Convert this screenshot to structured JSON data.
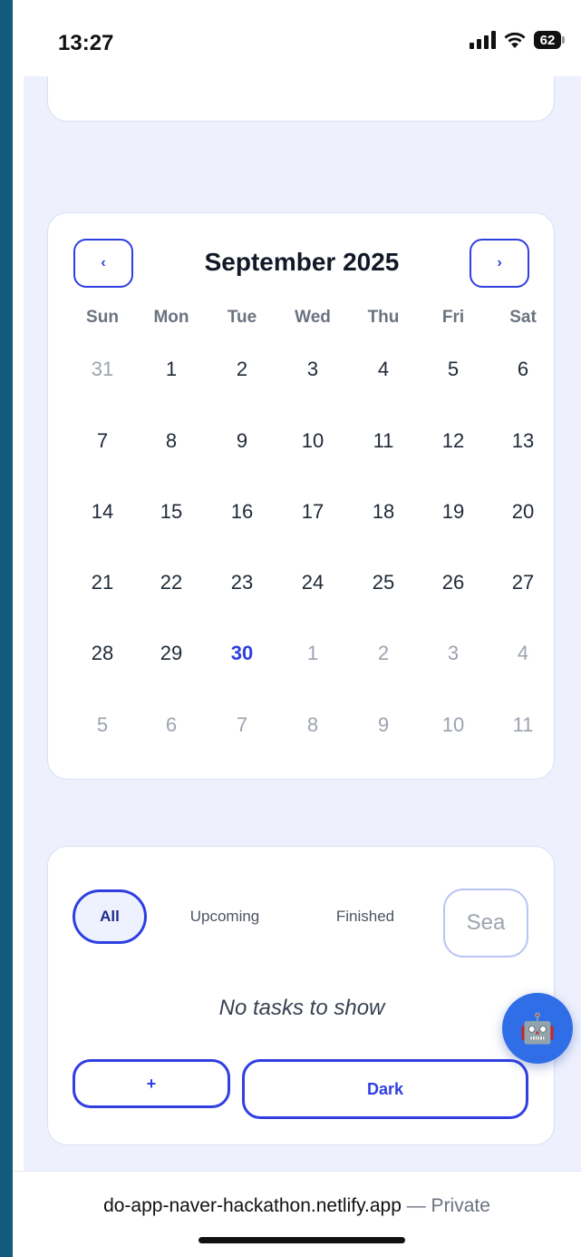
{
  "status_bar": {
    "time": "13:27",
    "battery": "62"
  },
  "calendar": {
    "month_title": "September 2025",
    "prev_label": "‹",
    "next_label": "›",
    "weekdays": [
      "Sun",
      "Mon",
      "Tue",
      "Wed",
      "Thu",
      "Fri",
      "Sat"
    ],
    "weeks": [
      [
        "31",
        "1",
        "2",
        "3",
        "4",
        "5",
        "6"
      ],
      [
        "7",
        "8",
        "9",
        "10",
        "11",
        "12",
        "13"
      ],
      [
        "14",
        "15",
        "16",
        "17",
        "18",
        "19",
        "20"
      ],
      [
        "21",
        "22",
        "23",
        "24",
        "25",
        "26",
        "27"
      ],
      [
        "28",
        "29",
        "30",
        "1",
        "2",
        "3",
        "4"
      ],
      [
        "5",
        "6",
        "7",
        "8",
        "9",
        "10",
        "11"
      ]
    ],
    "today": "30"
  },
  "tasks": {
    "filters": {
      "all": "All",
      "upcoming": "Upcoming",
      "finished": "Finished"
    },
    "search_placeholder": "Sea",
    "empty_text": "No tasks to show",
    "add_label": "+",
    "dark_label": "Dark"
  },
  "fab": {
    "icon": "🤖",
    "icon_name": "robot-icon"
  },
  "url_bar": {
    "domain": "do-app-naver-hackathon.netlify.app",
    "suffix": " — Private"
  },
  "colors": {
    "accent": "#2f3fe0",
    "background": "#eef1fd",
    "outer": "#125b7c",
    "fab": "#2f6ee6"
  }
}
